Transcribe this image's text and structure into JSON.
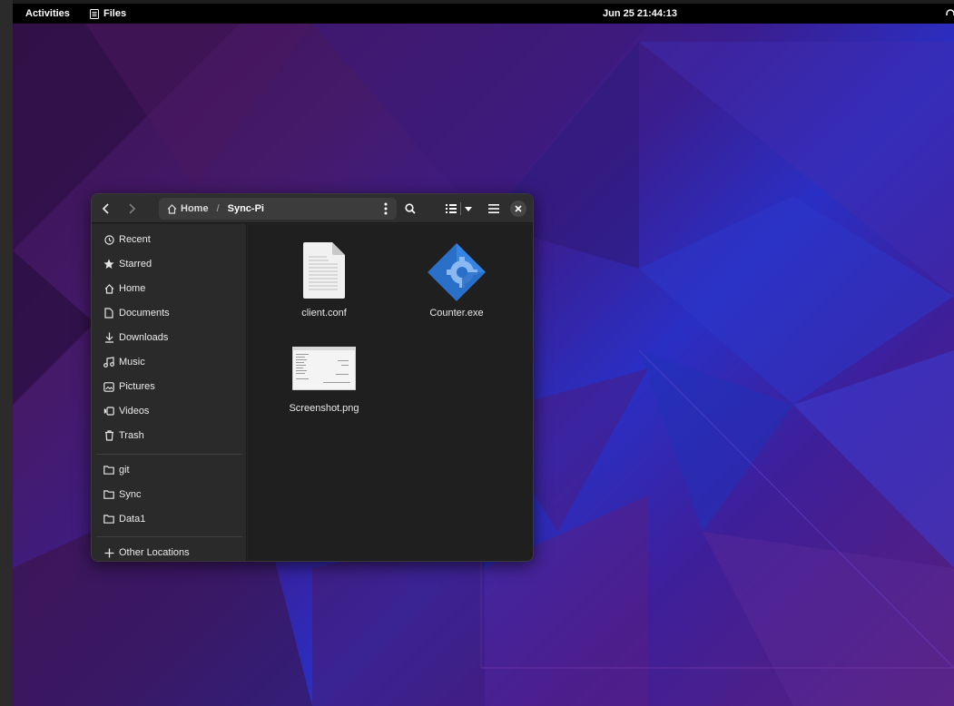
{
  "topbar": {
    "activities": "Activities",
    "app_name": "Files",
    "clock": "Jun 25  21:44:13"
  },
  "window": {
    "breadcrumb": {
      "home": "Home",
      "separator": "/",
      "current": "Sync-Pi"
    },
    "sidebar": {
      "places": [
        {
          "label": "Recent",
          "icon": "clock-icon"
        },
        {
          "label": "Starred",
          "icon": "star-icon"
        },
        {
          "label": "Home",
          "icon": "home-icon"
        },
        {
          "label": "Documents",
          "icon": "document-icon"
        },
        {
          "label": "Downloads",
          "icon": "download-icon"
        },
        {
          "label": "Music",
          "icon": "music-icon"
        },
        {
          "label": "Pictures",
          "icon": "picture-icon"
        },
        {
          "label": "Videos",
          "icon": "video-icon"
        },
        {
          "label": "Trash",
          "icon": "trash-icon"
        }
      ],
      "bookmarks": [
        {
          "label": "git",
          "icon": "folder-icon"
        },
        {
          "label": "Sync",
          "icon": "folder-icon"
        },
        {
          "label": "Data1",
          "icon": "folder-icon"
        }
      ],
      "other": {
        "label": "Other Locations",
        "icon": "plus-icon"
      }
    },
    "files": [
      {
        "name": "client.conf",
        "icon": "text-file-icon"
      },
      {
        "name": "Counter.exe",
        "icon": "executable-icon"
      },
      {
        "name": "Screenshot.png",
        "icon": "image-thumbnail-icon"
      }
    ]
  },
  "colors": {
    "accent": "#3584e4",
    "window_bg": "#242424",
    "sidebar_bg": "#2a2a2a"
  }
}
